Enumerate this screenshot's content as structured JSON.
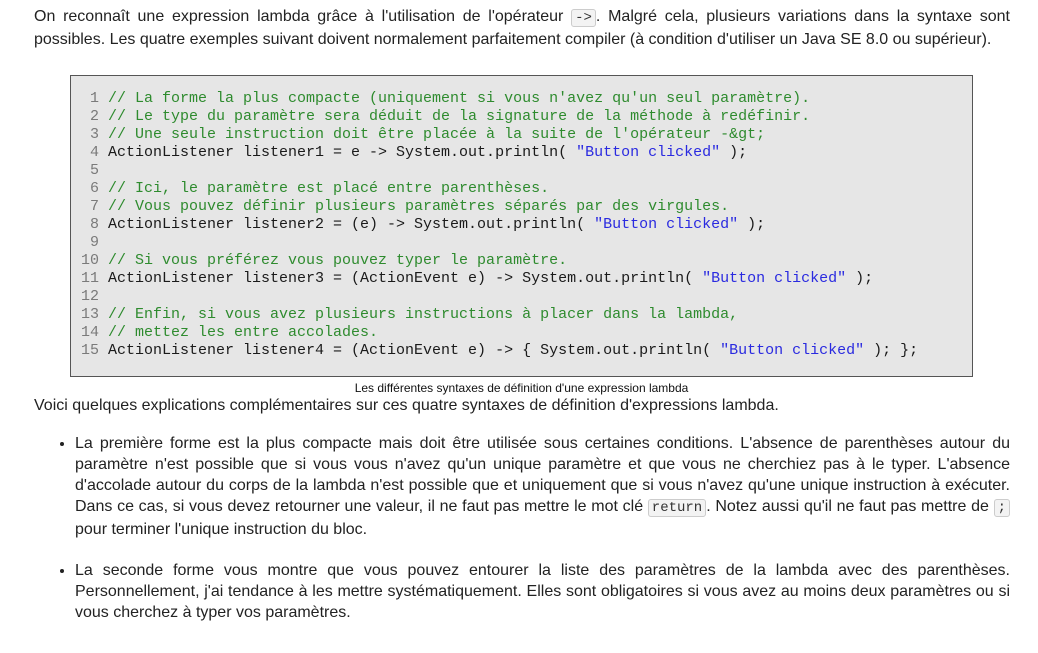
{
  "intro": {
    "part1": "On reconnaît une expression lambda grâce à l'utilisation de l'opérateur ",
    "operator": "->",
    "part2": ". Malgré cela, plusieurs variations dans la syntaxe sont possibles. Les quatre exemples suivant doivent normalement parfaitement compiler (à condition d'utiliser un Java SE 8.0 ou supérieur)."
  },
  "code": {
    "lines": [
      {
        "n": "1",
        "segs": [
          {
            "t": "// La forme la plus compacte (uniquement si vous n'avez qu'un seul paramètre).",
            "c": "cm"
          }
        ]
      },
      {
        "n": "2",
        "segs": [
          {
            "t": "// Le type du paramètre sera déduit de la signature de la méthode à redéfinir.",
            "c": "cm"
          }
        ]
      },
      {
        "n": "3",
        "segs": [
          {
            "t": "// Une seule instruction doit être placée à la suite de l'opérateur -&gt;",
            "c": "cm"
          }
        ]
      },
      {
        "n": "4",
        "segs": [
          {
            "t": "ActionListener listener1 = e -> System.out.println( ",
            "c": ""
          },
          {
            "t": "\"Button clicked\"",
            "c": "str"
          },
          {
            "t": " );",
            "c": ""
          }
        ]
      },
      {
        "n": "5",
        "segs": []
      },
      {
        "n": "6",
        "segs": [
          {
            "t": "// Ici, le paramètre est placé entre parenthèses.",
            "c": "cm"
          }
        ]
      },
      {
        "n": "7",
        "segs": [
          {
            "t": "// Vous pouvez définir plusieurs paramètres séparés par des virgules.",
            "c": "cm"
          }
        ]
      },
      {
        "n": "8",
        "segs": [
          {
            "t": "ActionListener listener2 = (e) -> System.out.println( ",
            "c": ""
          },
          {
            "t": "\"Button clicked\"",
            "c": "str"
          },
          {
            "t": " );",
            "c": ""
          }
        ]
      },
      {
        "n": "9",
        "segs": []
      },
      {
        "n": "10",
        "segs": [
          {
            "t": "// Si vous préférez vous pouvez typer le paramètre.",
            "c": "cm"
          }
        ]
      },
      {
        "n": "11",
        "segs": [
          {
            "t": "ActionListener listener3 = (ActionEvent e) -> System.out.println( ",
            "c": ""
          },
          {
            "t": "\"Button clicked\"",
            "c": "str"
          },
          {
            "t": " );",
            "c": ""
          }
        ]
      },
      {
        "n": "12",
        "segs": []
      },
      {
        "n": "13",
        "segs": [
          {
            "t": "// Enfin, si vous avez plusieurs instructions à placer dans la lambda,",
            "c": "cm"
          }
        ]
      },
      {
        "n": "14",
        "segs": [
          {
            "t": "// mettez les entre accolades.",
            "c": "cm"
          }
        ]
      },
      {
        "n": "15",
        "segs": [
          {
            "t": "ActionListener listener4 = (ActionEvent e) -> { System.out.println( ",
            "c": ""
          },
          {
            "t": "\"Button clicked\"",
            "c": "str"
          },
          {
            "t": " ); };",
            "c": ""
          }
        ]
      }
    ],
    "caption": "Les différentes syntaxes de définition d'une expression lambda"
  },
  "explain": "Voici quelques explications complémentaires sur ces quatre syntaxes de définition d'expressions lambda.",
  "bullets": {
    "b1": {
      "part1": "La première forme est la plus compacte mais doit être utilisée sous certaines conditions. L'absence de parenthèses autour du paramètre n'est possible que si vous vous n'avez qu'un unique paramètre et que vous ne cherchiez pas à le typer. L'absence d'accolade autour du corps de la lambda n'est possible que et uniquement que si vous n'avez qu'une unique instruction à exécuter. Dans ce cas, si vous devez retourner une valeur, il ne faut pas mettre le mot clé ",
      "kw_return": "return",
      "part2": ". Notez aussi qu'il ne faut pas mettre de ",
      "kw_semicolon": ";",
      "part3": " pour terminer l'unique instruction du bloc."
    },
    "b2": "La seconde forme vous montre que vous pouvez entourer la liste des paramètres de la lambda avec des parenthèses. Personnellement, j'ai tendance à les mettre systématiquement. Elles sont obligatoires si vous avez au moins deux paramètres ou si vous cherchez à typer vos paramètres."
  }
}
